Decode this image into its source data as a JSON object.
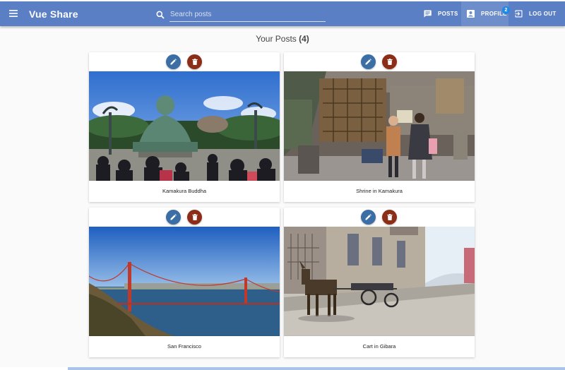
{
  "app": {
    "title": "Vue Share"
  },
  "search": {
    "placeholder": "Search posts"
  },
  "nav": {
    "posts_label": "POSTS",
    "profile_label": "PROFILE",
    "profile_badge": "2",
    "logout_label": "LOG OUT"
  },
  "heading": {
    "text": "Your Posts",
    "count": "(4)"
  },
  "posts": [
    {
      "title": "Kamakura Buddha"
    },
    {
      "title": "Shrine in Kamakura"
    },
    {
      "title": "San Francisco"
    },
    {
      "title": "Cart in Gibara"
    }
  ],
  "colors": {
    "toolbar": "#5b7fc4",
    "edit_button": "#3a6ea5",
    "delete_button": "#8b2d17",
    "badge": "#1e88e5"
  },
  "icons": {
    "menu": "menu-icon",
    "search": "search-icon",
    "posts": "chat-icon",
    "profile": "account-box-icon",
    "logout": "exit-icon",
    "edit": "pencil-icon",
    "delete": "trash-icon"
  }
}
